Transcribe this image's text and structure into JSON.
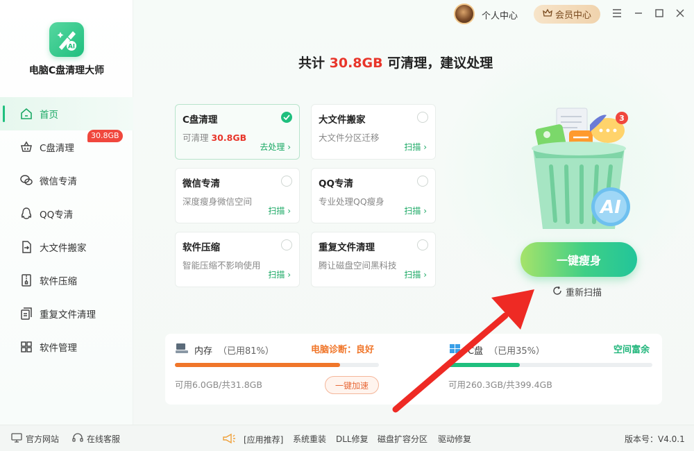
{
  "app": {
    "name": "电脑C盘清理大师"
  },
  "topbar": {
    "personal": "个人中心",
    "vip": "会员中心"
  },
  "sidebar": {
    "items": [
      {
        "label": "首页"
      },
      {
        "label": "C盘清理"
      },
      {
        "label": "微信专清"
      },
      {
        "label": "QQ专清"
      },
      {
        "label": "大文件搬家"
      },
      {
        "label": "软件压缩"
      },
      {
        "label": "重复文件清理"
      },
      {
        "label": "软件管理"
      }
    ],
    "badge": "30.8GB"
  },
  "headline": {
    "prefix": "共计 ",
    "amount": "30.8GB",
    "suffix": " 可清理，建议处理"
  },
  "cards": [
    {
      "title": "C盘清理",
      "desc_prefix": "可清理 ",
      "desc_value": "30.8GB",
      "link": "去处理 ›",
      "selected": true
    },
    {
      "title": "大文件搬家",
      "desc": "大文件分区迁移",
      "link": "扫描 ›"
    },
    {
      "title": "微信专清",
      "desc": "深度瘦身微信空间",
      "link": "扫描 ›"
    },
    {
      "title": "QQ专清",
      "desc": "专业处理QQ瘦身",
      "link": "扫描 ›"
    },
    {
      "title": "软件压缩",
      "desc": "智能压缩不影响使用",
      "link": "扫描 ›"
    },
    {
      "title": "重复文件清理",
      "desc": "腾让磁盘空间黑科技",
      "link": "扫描 ›"
    }
  ],
  "action": {
    "main": "一键瘦身",
    "rescan": "重新扫描",
    "bin_badge": "3",
    "bin_label": "AI"
  },
  "stats": {
    "memory": {
      "label": "内存",
      "used": "（已用81%）",
      "fraction": 0.81,
      "sub": "可用6.0GB/共31.8GB",
      "diag_label": "电脑诊断：良好",
      "accel": "一键加速"
    },
    "disk": {
      "label": "C盘",
      "used": "（已用35%）",
      "fraction": 0.35,
      "sub": "可用260.3GB/共399.4GB",
      "status": "空间富余"
    }
  },
  "footer": {
    "site": "官方网站",
    "service": "在线客服",
    "rec": "[应用推荐]",
    "links": [
      "系统重装",
      "DLL修复",
      "磁盘扩容分区",
      "驱动修复"
    ],
    "version": "版本号：V4.0.1"
  },
  "colors": {
    "accent": "#1fbf7e",
    "highlight": "#e8352a",
    "memory_bar": "#f0762a",
    "disk_bar": "#1fbf7e"
  }
}
